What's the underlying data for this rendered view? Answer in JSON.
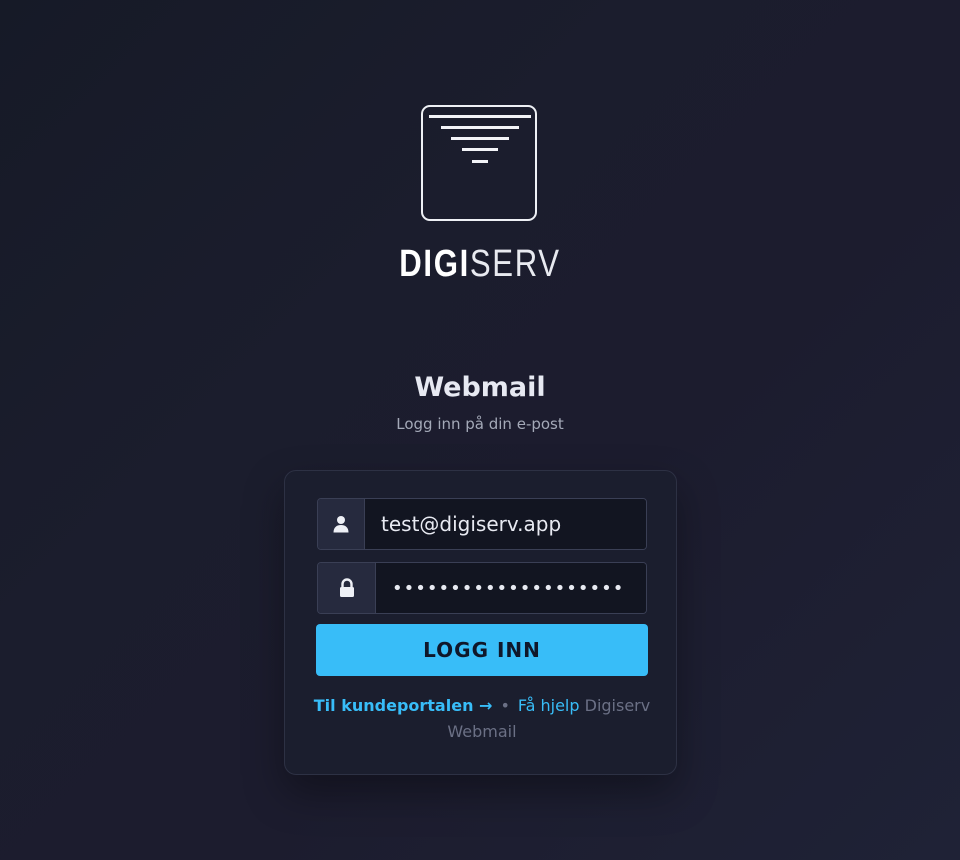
{
  "brand": {
    "name_bold": "DIGI",
    "name_light": "SERV"
  },
  "page": {
    "title": "Webmail",
    "subtitle": "Logg inn på din e-post"
  },
  "form": {
    "username_value": "test@digiserv.app",
    "password_value": "••••••••••••••••••••",
    "submit_label": "LOGG INN"
  },
  "footer": {
    "portal_link": "Til kundeportalen →",
    "separator": "•",
    "help_link": "Få hjelp",
    "app_name": "Digiserv Webmail"
  },
  "icons": {
    "logo": "digiserv-logo-icon",
    "username": "user-icon",
    "password": "lock-icon"
  },
  "colors": {
    "accent": "#38bdf8",
    "background": "#1b1d2d",
    "card": "#1b1e2e"
  }
}
